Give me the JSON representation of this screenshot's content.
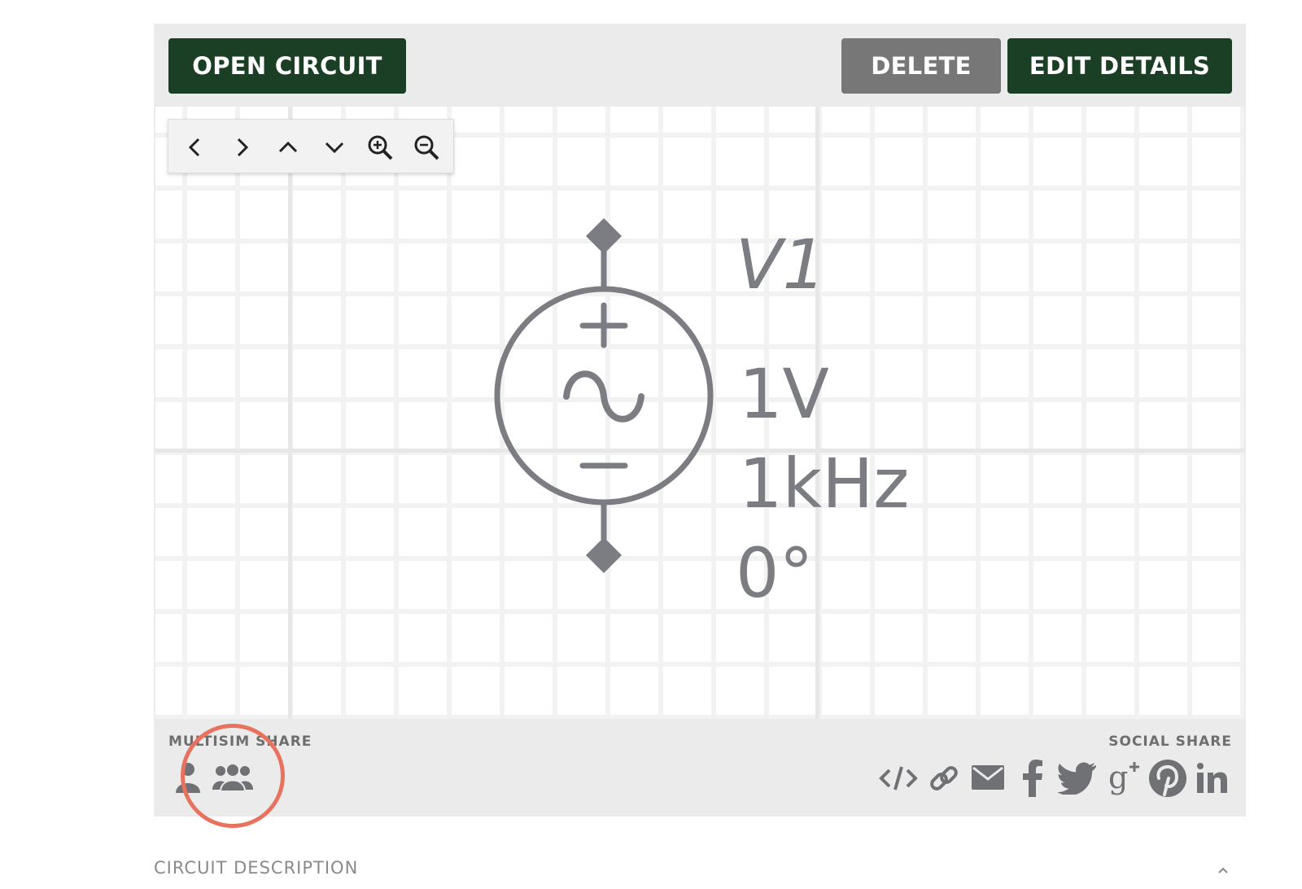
{
  "toolbar": {
    "open_label": "OPEN CIRCUIT",
    "delete_label": "DELETE",
    "edit_label": "EDIT DETAILS",
    "colors": {
      "primary": "#1b3f24",
      "secondary": "#777777"
    }
  },
  "canvas_nav": {
    "buttons": [
      "chevron-left-icon",
      "chevron-right-icon",
      "chevron-up-icon",
      "chevron-down-icon",
      "zoom-in-icon",
      "zoom-out-icon"
    ]
  },
  "schematic": {
    "component": "ac-voltage-source",
    "name": "V1",
    "voltage": "1V",
    "frequency": "1kHz",
    "phase": "0°",
    "color": "#7b7d82"
  },
  "share": {
    "multisim_heading": "MULTISIM SHARE",
    "multisim_icons": [
      "user-icon",
      "group-icon"
    ],
    "social_heading": "SOCIAL SHARE",
    "social_icons": [
      "embed-icon",
      "link-icon",
      "email-icon",
      "facebook-icon",
      "twitter-icon",
      "google-plus-icon",
      "pinterest-icon",
      "linkedin-icon"
    ],
    "highlight_color": "#e8725e"
  },
  "description": {
    "heading": "CIRCUIT DESCRIPTION"
  }
}
